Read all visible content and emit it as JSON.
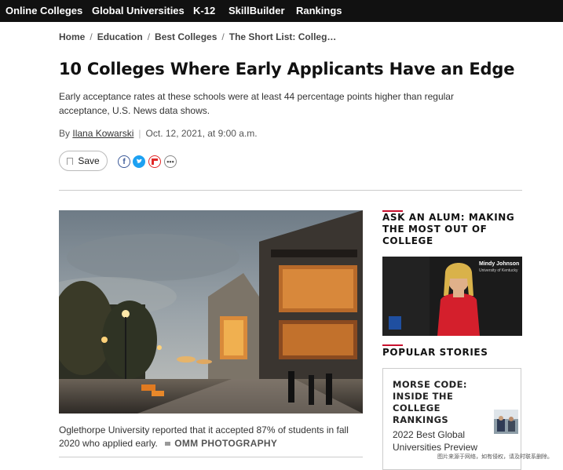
{
  "nav": {
    "items": [
      "Online Colleges",
      "Global Universities",
      "K-12",
      "SkillBuilder",
      "Rankings"
    ]
  },
  "breadcrumb": [
    "Home",
    "Education",
    "Best Colleges",
    "The Short List: Colleg…"
  ],
  "article": {
    "title": "10 Colleges Where Early Applicants Have an Edge",
    "dek": "Early acceptance rates at these schools were at least 44 percentage points higher than regular acceptance, U.S. News data shows.",
    "by_prefix": "By",
    "author": "Ilana Kowarski",
    "date": "Oct. 12, 2021, at 9:00 a.m.",
    "save_label": "Save",
    "caption": "Oglethorpe University reported that it accepted 87% of students in fall 2020 who applied early.",
    "credit": "OMM PHOTOGRAPHY"
  },
  "sidebar": {
    "ask_alum_heading": "ASK AN ALUM: MAKING THE MOST OUT OF COLLEGE",
    "video_name": "Mindy Johnson",
    "video_subtitle": "University of Kentucky",
    "popular_heading": "POPULAR STORIES",
    "story_kicker": "MORSE CODE: INSIDE THE COLLEGE RANKINGS",
    "story_title": "2022 Best Global Universities Preview"
  },
  "watermark": "图片来源于网络，如有侵权，请及时联系删除。",
  "colors": {
    "nav_bg": "#111111",
    "accent_red": "#c8102e"
  },
  "icons": [
    "facebook-icon",
    "twitter-icon",
    "flipboard-icon",
    "more-icon",
    "bookmark-icon",
    "camera-icon"
  ]
}
